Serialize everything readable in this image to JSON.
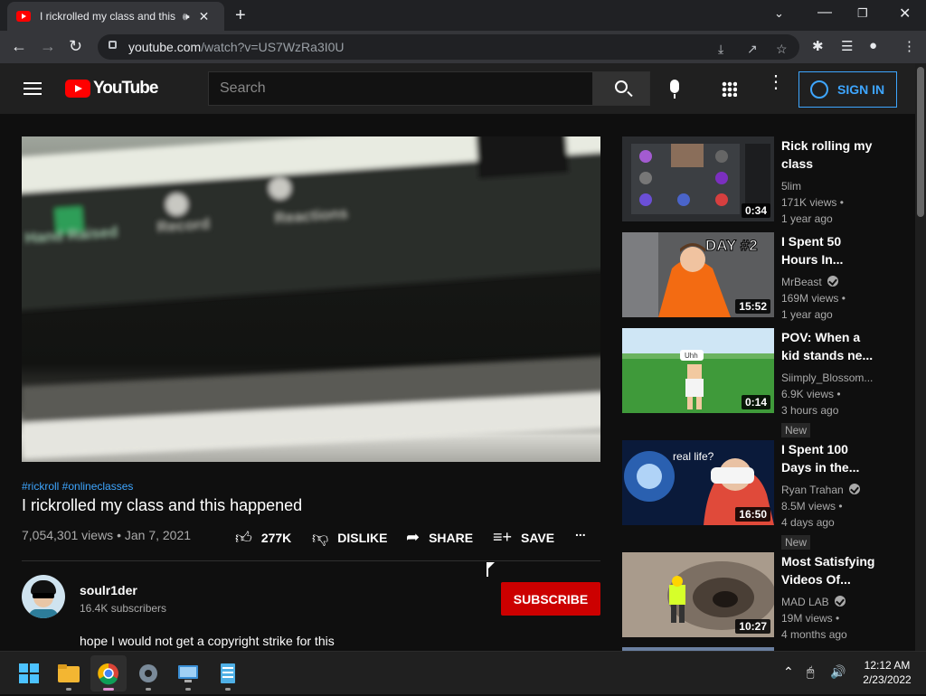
{
  "browser": {
    "tab_title": "I rickrolled my class and this",
    "tab_audio_icon": "speaker-icon",
    "new_tab_label": "+",
    "url_host": "youtube.com",
    "url_path": "/watch?v=US7WzRa3I0U",
    "window_controls": [
      "chevron-down-icon",
      "minimize-icon",
      "restore-icon",
      "close-icon"
    ],
    "toolbar_icons": [
      "install-icon",
      "share-icon",
      "star-icon",
      "extensions-icon",
      "media-icon",
      "profile-icon",
      "menu-icon"
    ]
  },
  "youtube_header": {
    "logo_text": "YouTube",
    "search_placeholder": "Search",
    "sign_in_label": "SIGN IN"
  },
  "video": {
    "hashtags": "#rickroll #onlineclasses",
    "title": "I rickrolled my class and this happened",
    "meta": "7,054,301 views • Jan 7, 2021",
    "like_count": "277K",
    "dislike_label": "DISLIKE",
    "share_label": "SHARE",
    "save_label": "SAVE",
    "more_label": "..."
  },
  "overlay_text": {
    "line1": "Hand Raised",
    "line2": "Record",
    "line3": "Reactions"
  },
  "channel": {
    "name": "soulr1der",
    "subscribers": "16.4K subscribers",
    "subscribe_label": "SUBSCRIBE",
    "description": "hope I would not get a copyright strike for this"
  },
  "related": [
    {
      "title": "Rick rolling my class",
      "channel": "5lim",
      "verified": false,
      "views": "171K views •",
      "age": "1 year ago",
      "duration": "0:34",
      "badge": ""
    },
    {
      "title": "I Spent 50 Hours In...",
      "channel": "MrBeast",
      "verified": true,
      "views": "169M views •",
      "age": "1 year ago",
      "duration": "15:52",
      "badge": "",
      "thumb_text": "DAY #2"
    },
    {
      "title": "POV: When a kid stands ne...",
      "channel": "Siimply_Blossom...",
      "verified": false,
      "views": "6.9K views •",
      "age": "3 hours ago",
      "duration": "0:14",
      "badge": "New",
      "thumb_text": "Uhh"
    },
    {
      "title": "I Spent 100 Days in the...",
      "channel": "Ryan Trahan",
      "verified": true,
      "views": "8.5M views •",
      "age": "4 days ago",
      "duration": "16:50",
      "badge": "New",
      "thumb_text": "real life?"
    },
    {
      "title": "Most Satisfying Videos Of...",
      "channel": "MAD LAB",
      "verified": true,
      "views": "19M views •",
      "age": "4 months ago",
      "duration": "10:27",
      "badge": ""
    }
  ],
  "taskbar": {
    "apps": [
      "windows-start-icon",
      "file-explorer-icon",
      "chrome-icon",
      "settings-icon",
      "remote-desktop-icon",
      "notepad-icon"
    ],
    "time": "12:12 AM",
    "date": "2/23/2022"
  },
  "colors": {
    "accent_blue": "#3ea6ff",
    "subscribe_red": "#cc0000",
    "youtube_red": "#ff0000",
    "background": "#0f0f0f"
  }
}
